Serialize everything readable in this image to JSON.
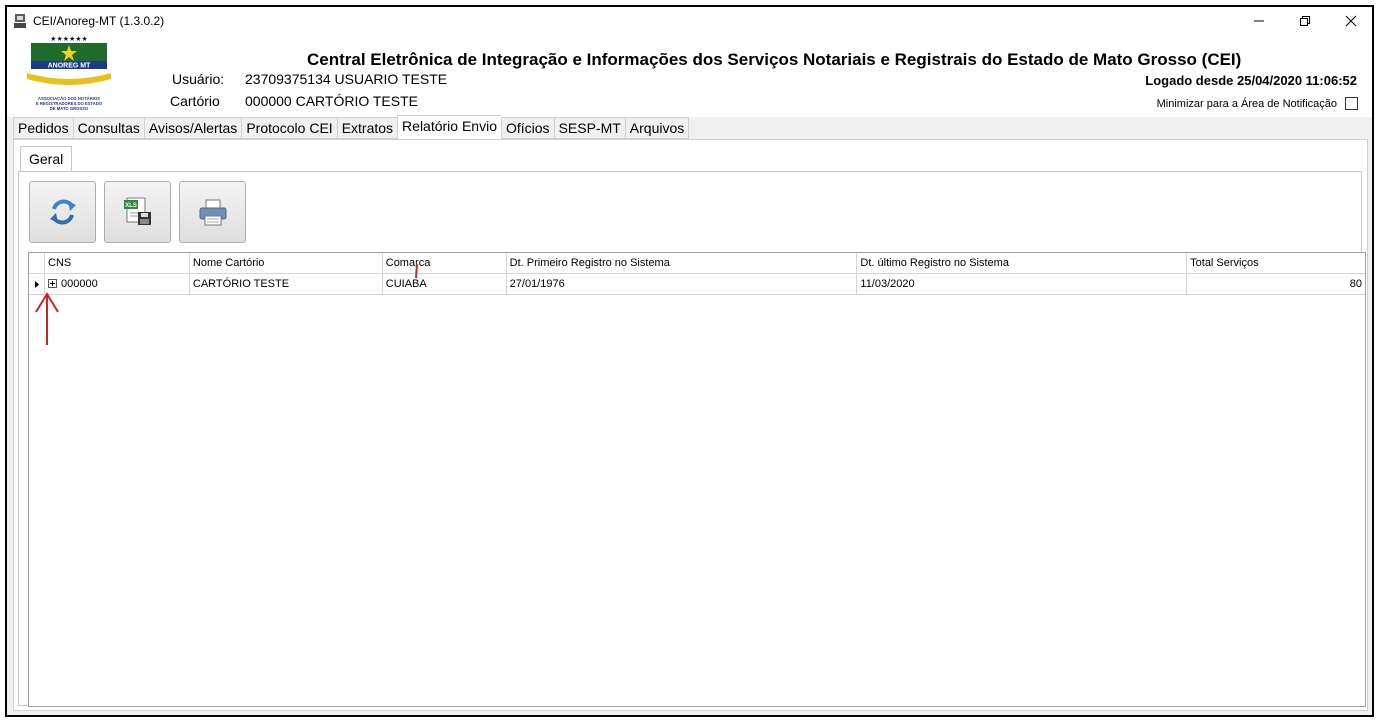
{
  "window": {
    "title": "CEI/Anoreg-MT (1.3.0.2)",
    "minimize_icon": "minimize-icon",
    "restore_icon": "restore-icon",
    "close_icon": "close-icon"
  },
  "header": {
    "logo_text": "ANOREG MT",
    "logo_subtext": "ASSOCIAÇÃO DOS NOTÁRIOS E REGISTRADORES DO ESTADO DE MATO GROSSO",
    "title": "Central Eletrônica de Integração e Informações dos Serviços Notariais e Registrais do Estado de Mato Grosso (CEI)",
    "usuario_label": "Usuário:",
    "usuario_value": "23709375134 USUARIO TESTE",
    "cartorio_label": "Cartório",
    "cartorio_value": "000000 CARTÓRIO TESTE",
    "logged_since": "Logado desde 25/04/2020 11:06:52",
    "minimize_notification": "Minimizar para a Área de Notificação"
  },
  "tabs": [
    "Pedidos",
    "Consultas",
    "Avisos/Alertas",
    "Protocolo CEI",
    "Extratos",
    "Relatório Envio",
    "Ofícios",
    "SESP-MT",
    "Arquivos"
  ],
  "active_tab": "Relatório Envio",
  "subtab": "Geral",
  "toolbar": {
    "refresh_icon": "refresh-icon",
    "export_xls_icon": "xls-export-icon",
    "print_icon": "printer-icon"
  },
  "grid": {
    "columns": [
      "CNS",
      "Nome Cartório",
      "Comarca",
      "Dt. Primeiro Registro no Sistema",
      "Dt. último Registro no Sistema",
      "Total Serviços"
    ],
    "rows": [
      [
        "000000",
        "CARTÓRIO TESTE",
        "CUIABA",
        "27/01/1976",
        "11/03/2020",
        "80"
      ]
    ]
  },
  "colors": {
    "annotation": "#d0202a",
    "window_bg": "#f0f0f0"
  }
}
